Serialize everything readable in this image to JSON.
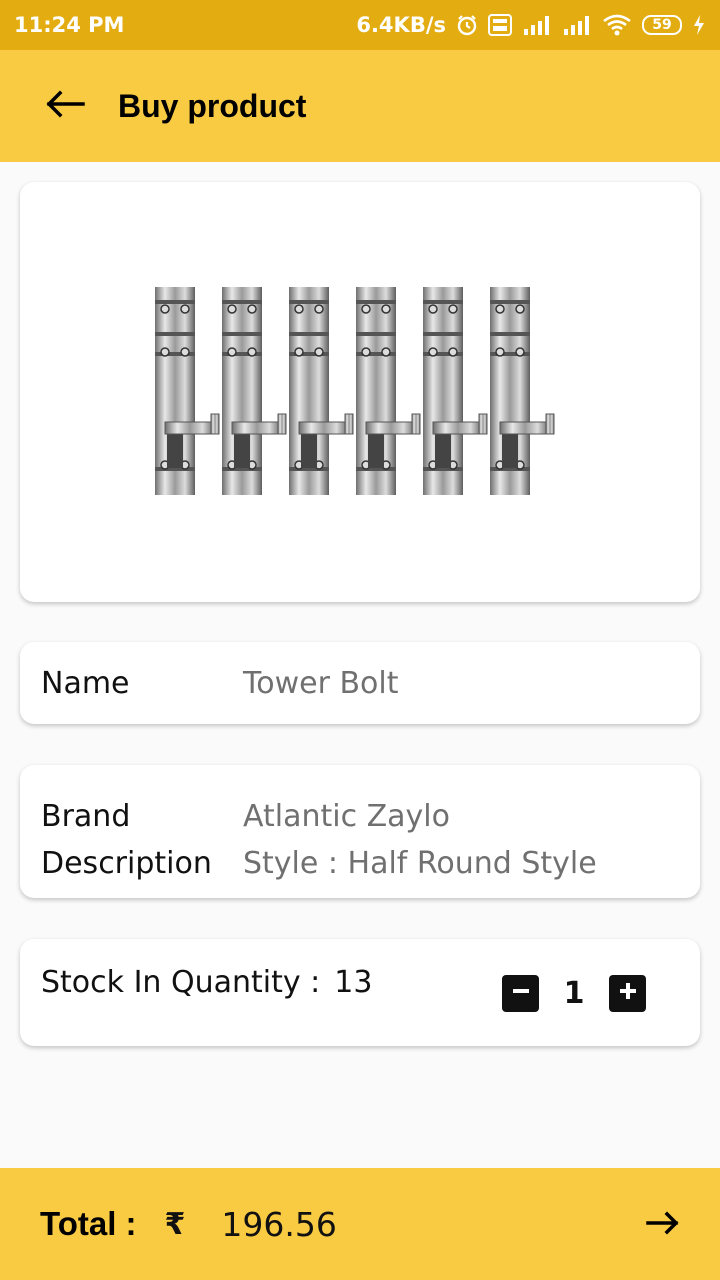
{
  "status_bar": {
    "time": "11:24 PM",
    "speed": "6.4KB/s",
    "battery": "59",
    "icons": [
      "alarm-icon",
      "volte-icon",
      "signal-4g-icon",
      "signal-icon",
      "wifi-icon",
      "battery-icon",
      "charging-icon"
    ]
  },
  "app_bar": {
    "title": "Buy product",
    "back_icon": "arrow-left-icon"
  },
  "product": {
    "image": "tower-bolt-product-image",
    "name_label": "Name",
    "name_value": "Tower Bolt",
    "brand_label": "Brand",
    "brand_value": "Atlantic Zaylo",
    "description_label": "Description",
    "description_value": "Style : Half Round Style"
  },
  "stock": {
    "label": "Stock In Quantity :",
    "value": "13"
  },
  "quantity": {
    "value": "1",
    "minus_icon": "minus-square-icon",
    "plus_icon": "plus-square-icon"
  },
  "footer": {
    "total_label": "Total :",
    "currency": "₹",
    "total_value": "196.56",
    "next_icon": "arrow-right-icon"
  },
  "colors": {
    "status_bar": "#e3ad12",
    "app_bar": "#f9cb43",
    "background": "#fafafa"
  }
}
